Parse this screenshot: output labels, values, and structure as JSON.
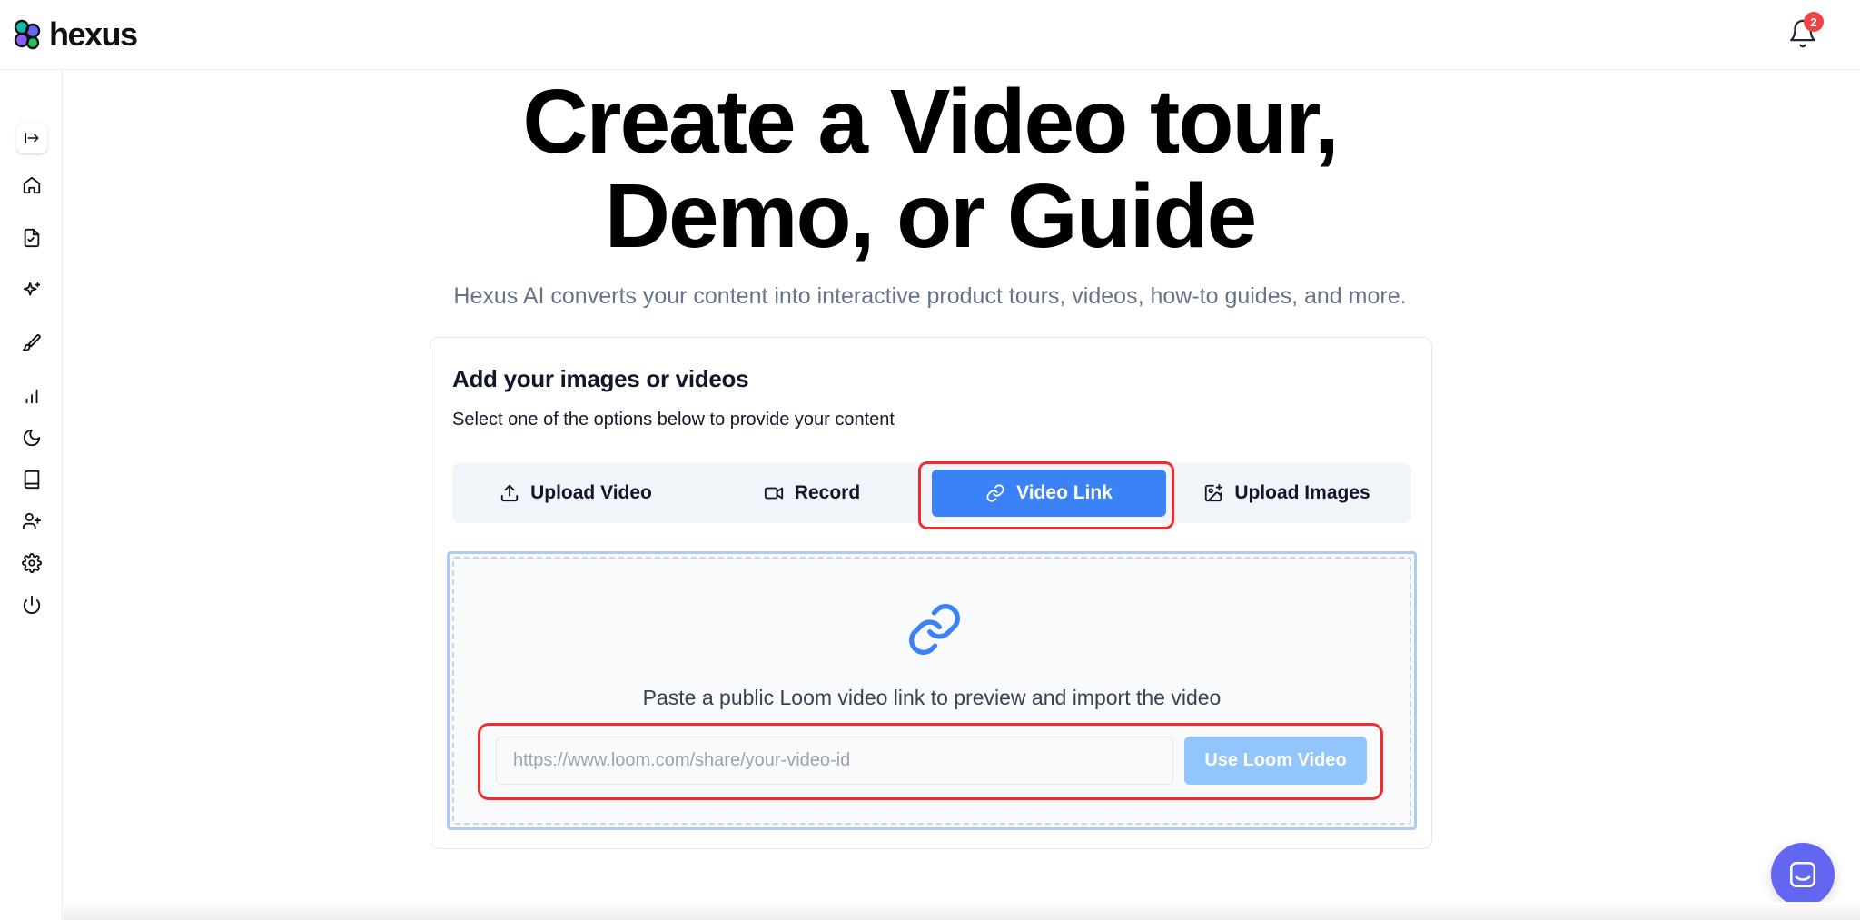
{
  "header": {
    "brand": "hexus",
    "notification_count": "2"
  },
  "sidebar": {
    "items": [
      {
        "icon": "expand-sidebar-icon"
      },
      {
        "icon": "home-icon"
      },
      {
        "icon": "document-check-icon"
      },
      {
        "icon": "sparkles-icon"
      },
      {
        "icon": "brush-icon"
      },
      {
        "icon": "bar-chart-icon"
      },
      {
        "icon": "moon-icon"
      },
      {
        "icon": "book-icon"
      },
      {
        "icon": "add-user-icon"
      },
      {
        "icon": "settings-icon"
      },
      {
        "icon": "power-icon"
      }
    ]
  },
  "hero": {
    "title_line1": "Create a Video tour,",
    "title_line2": "Demo, or Guide",
    "subtitle": "Hexus AI converts your content into interactive product tours, videos, how-to guides, and more."
  },
  "card": {
    "title": "Add your images or videos",
    "description": "Select one of the options below to provide your content",
    "tabs": [
      {
        "label": "Upload Video",
        "icon": "upload-icon",
        "active": false
      },
      {
        "label": "Record",
        "icon": "video-camera-icon",
        "active": false
      },
      {
        "label": "Video Link",
        "icon": "link-icon",
        "active": true
      },
      {
        "label": "Upload Images",
        "icon": "image-upload-icon",
        "active": false
      }
    ],
    "dropzone": {
      "instruction": "Paste a public Loom video link to preview and import the video",
      "input_placeholder": "https://www.loom.com/share/your-video-id",
      "input_value": "",
      "button_label": "Use Loom Video"
    }
  },
  "colors": {
    "accent": "#3b82f6",
    "accent_disabled": "#93c5fd",
    "highlight": "#ef2b2b",
    "badge": "#ef4444",
    "chat": "#6366f1"
  }
}
